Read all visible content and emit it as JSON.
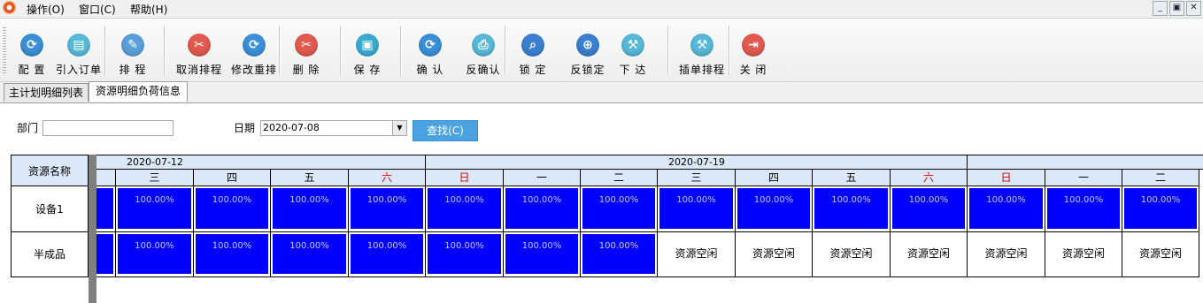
{
  "menu": {
    "items": [
      "操作(O)",
      "窗口(C)",
      "帮助(H)"
    ]
  },
  "window_controls": [
    "_",
    "▣",
    "✕"
  ],
  "toolbar": {
    "buttons": [
      {
        "label": "配 置",
        "icon": "refresh-icon",
        "color": "#3b8fd6"
      },
      {
        "label": "引入订单",
        "icon": "document-icon",
        "color": "#58b8d8"
      },
      {
        "label": "排 程",
        "icon": "edit-icon",
        "color": "#5a9fd8"
      },
      {
        "label": "取消排程",
        "icon": "tools-icon",
        "color": "#e05a50"
      },
      {
        "label": "修改重排",
        "icon": "refresh-icon",
        "color": "#3b8fd6"
      },
      {
        "label": "删 除",
        "icon": "tools-icon",
        "color": "#e05a50"
      },
      {
        "label": "保 存",
        "icon": "save-icon",
        "color": "#3aaad0"
      },
      {
        "label": "确 认",
        "icon": "refresh-icon",
        "color": "#3b8fd6"
      },
      {
        "label": "反确认",
        "icon": "print-icon",
        "color": "#58b8d8"
      },
      {
        "label": "锁 定",
        "icon": "search-icon",
        "color": "#3b7fd0"
      },
      {
        "label": "反锁定",
        "icon": "search-plus-icon",
        "color": "#3b7fd0"
      },
      {
        "label": "下 达",
        "icon": "stamp-icon",
        "color": "#58b8d8"
      },
      {
        "label": "插单排程",
        "icon": "stamp-icon",
        "color": "#58b8d8"
      },
      {
        "label": "关 闭",
        "icon": "exit-icon",
        "color": "#e05a50"
      }
    ]
  },
  "tabs": [
    "主计划明细列表",
    "资源明细负荷信息"
  ],
  "filters": {
    "department_label": "部门",
    "department_value": "",
    "date_label": "日期",
    "date_value": "2020-07-08",
    "search_label": "查找(C)"
  },
  "grid": {
    "resource_header": "资源名称",
    "weeks": [
      "2020-07-12",
      "2020-07-19",
      ""
    ],
    "days": [
      {
        "label": "",
        "red": false
      },
      {
        "label": "三",
        "red": false
      },
      {
        "label": "四",
        "red": false
      },
      {
        "label": "五",
        "red": false
      },
      {
        "label": "六",
        "red": true
      },
      {
        "label": "日",
        "red": true
      },
      {
        "label": "一",
        "red": false
      },
      {
        "label": "二",
        "red": false
      },
      {
        "label": "三",
        "red": false
      },
      {
        "label": "四",
        "red": false
      },
      {
        "label": "五",
        "red": false
      },
      {
        "label": "六",
        "red": true
      },
      {
        "label": "日",
        "red": true
      },
      {
        "label": "一",
        "red": false
      },
      {
        "label": "二",
        "red": false
      }
    ],
    "rows": [
      {
        "name": "设备1",
        "cells": [
          "",
          "100.00%",
          "100.00%",
          "100.00%",
          "100.00%",
          "100.00%",
          "100.00%",
          "100.00%",
          "100.00%",
          "100.00%",
          "100.00%",
          "100.00%",
          "100.00%",
          "100.00%",
          "100.00%"
        ]
      },
      {
        "name": "半成品",
        "cells": [
          "",
          "100.00%",
          "100.00%",
          "100.00%",
          "100.00%",
          "100.00%",
          "100.00%",
          "100.00%",
          "资源空闲",
          "资源空闲",
          "资源空闲",
          "资源空闲",
          "资源空闲",
          "资源空闲",
          "资源空闲"
        ]
      }
    ],
    "load_color": "#0000ff"
  }
}
